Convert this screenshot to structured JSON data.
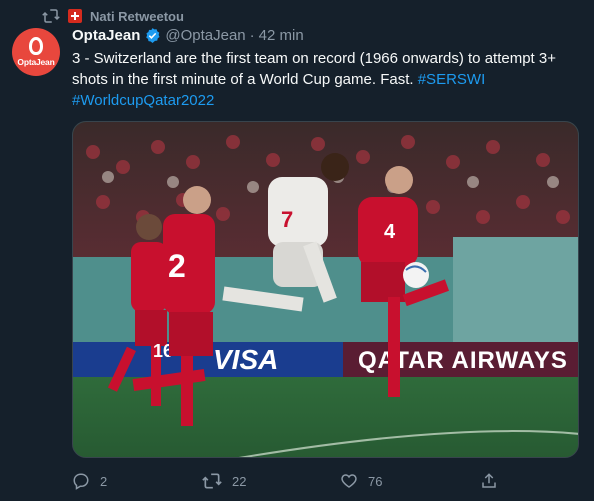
{
  "retweet": {
    "label": "Nati Retweetou",
    "icon": "retweet-icon",
    "flag_icon": "swiss-flag-icon"
  },
  "avatar": {
    "brand": "OptaJean",
    "color": "#e8473d"
  },
  "author": {
    "name": "OptaJean",
    "handle": "@OptaJean",
    "separator": "·",
    "time": "42 min",
    "verified_icon": "verified-badge-icon"
  },
  "tweet": {
    "text": "3 - Switzerland are the first team on record (1966 onwards) to attempt 3+ shots in the first minute of a World Cup game. Fast.",
    "hashtags": [
      "#SERSWI",
      "#WorldcupQatar2022"
    ]
  },
  "media": {
    "description_icon": "football-match-photo",
    "board_text_left": "VISA",
    "board_text_right": "QATAR AIRWAYS",
    "shirt_numbers": [
      "2",
      "4",
      "16",
      "7"
    ]
  },
  "actions": {
    "reply_count": "2",
    "retweet_count": "22",
    "like_count": "76"
  },
  "colors": {
    "background": "#15202b",
    "text": "#f7f9f9",
    "muted": "#8b98a5",
    "link": "#1d9bf0",
    "serbia_red": "#c8102e"
  }
}
